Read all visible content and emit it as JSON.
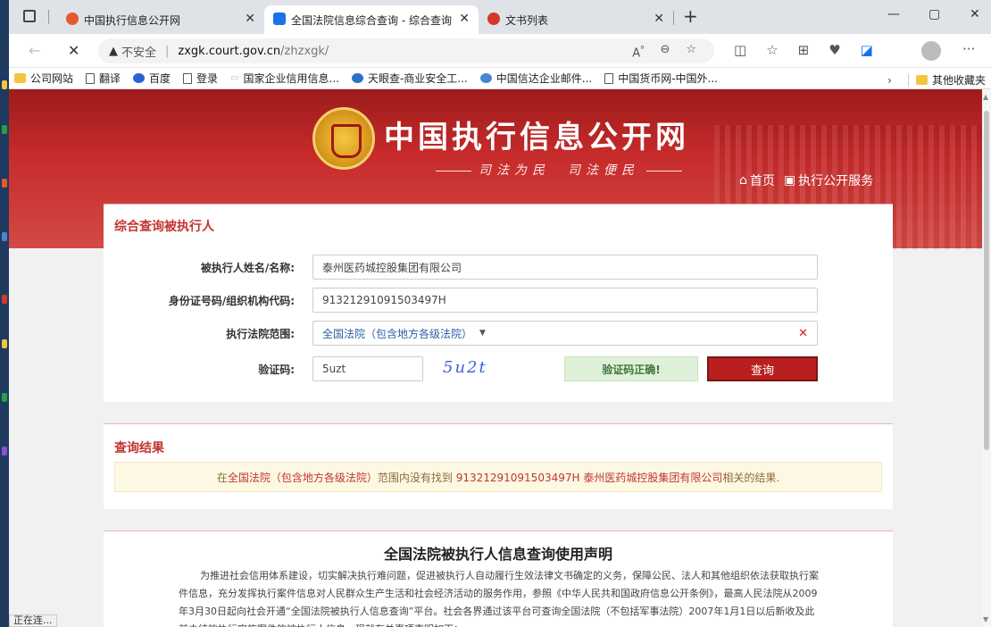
{
  "tabs": [
    {
      "title": "中国执行信息公开网",
      "active": false,
      "fav_color": "#e25b2b"
    },
    {
      "title": "全国法院信息综合查询 - 综合查询",
      "active": true,
      "fav_color": "#1a73e8"
    },
    {
      "title": "文书列表",
      "active": false,
      "fav_color": "#d33a2c"
    }
  ],
  "address": {
    "insecure_label": "不安全",
    "host": "zxgk.court.gov.cn",
    "path": "/zhzxgk/"
  },
  "bookmarks": [
    {
      "label": "公司网站",
      "icon": "folder-icon"
    },
    {
      "label": "翻译",
      "icon": "document-icon"
    },
    {
      "label": "百度",
      "icon": "baidu-icon"
    },
    {
      "label": "登录",
      "icon": "document-icon"
    },
    {
      "label": "国家企业信用信息...",
      "icon": "globe-icon"
    },
    {
      "label": "天眼查-商业安全工...",
      "icon": "tianyancha-icon"
    },
    {
      "label": "中国信达企业邮件...",
      "icon": "cinda-icon"
    },
    {
      "label": "中国货币网-中国外...",
      "icon": "document-icon"
    }
  ],
  "bookmarks_other": "其他收藏夹",
  "site": {
    "title": "中国执行信息公开网",
    "slogan": "司法为民　司法便民",
    "nav_home": "首页",
    "nav_service": "执行公开服务"
  },
  "search": {
    "title": "综合查询被执行人",
    "name_label": "被执行人姓名/名称:",
    "name_value": "泰州医药城控股集团有限公司",
    "id_label": "身份证号码/组织机构代码:",
    "id_value": "91321291091503497H",
    "court_label": "执行法院范围:",
    "court_value": "全国法院（包含地方各级法院）",
    "captcha_label": "验证码:",
    "captcha_value": "5uzt",
    "captcha_image_text": "5u2t",
    "captcha_ok": "验证码正确!",
    "query_button": "查询"
  },
  "result": {
    "title": "查询结果",
    "prefix": "在",
    "scope": "全国法院（包含地方各级法院）",
    "middle": "范围内没有找到",
    "target": "91321291091503497H 泰州医药城控股集团有限公司",
    "suffix": "相关的结果."
  },
  "declaration": {
    "title": "全国法院被执行人信息查询使用声明",
    "text": "为推进社会信用体系建设，切实解决执行难问题，促进被执行人自动履行生效法律文书确定的义务，保障公民、法人和其他组织依法获取执行案件信息，充分发挥执行案件信息对人民群众生产生活和社会经济活动的服务作用，参照《中华人民共和国政府信息公开条例》，最高人民法院从2009年3月30日起向社会开通“全国法院被执行人信息查询”平台。社会各界通过该平台可查询全国法院（不包括军事法院）2007年1月1日以后新收及此前未结的执行实施案件的被执行人信息，现就有关事项声明如下："
  },
  "status_text": "正在连..."
}
